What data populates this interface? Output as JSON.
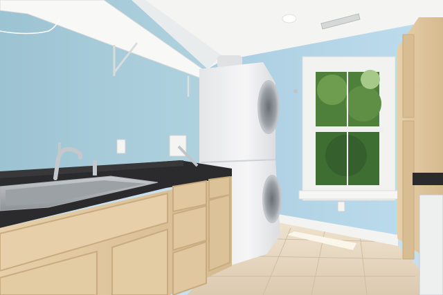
{
  "scene": {
    "type": "photo",
    "subject": "laundry room",
    "palette": {
      "wall_left": "#a7cbd8",
      "wall_right": "#b4d5e6",
      "ceiling": "#f5f5f3",
      "countertop": "#2b2b2e",
      "cabinet_wood": "#e1c9a3",
      "cabinet_wood_dark": "#c9ab80",
      "appliance_white": "#eeeeef",
      "floor_tile": "#e8d9c3",
      "window_greenery": "#4e7f3b",
      "window_frame": "#f2f2f0",
      "metal": "#b8bcc0"
    }
  }
}
